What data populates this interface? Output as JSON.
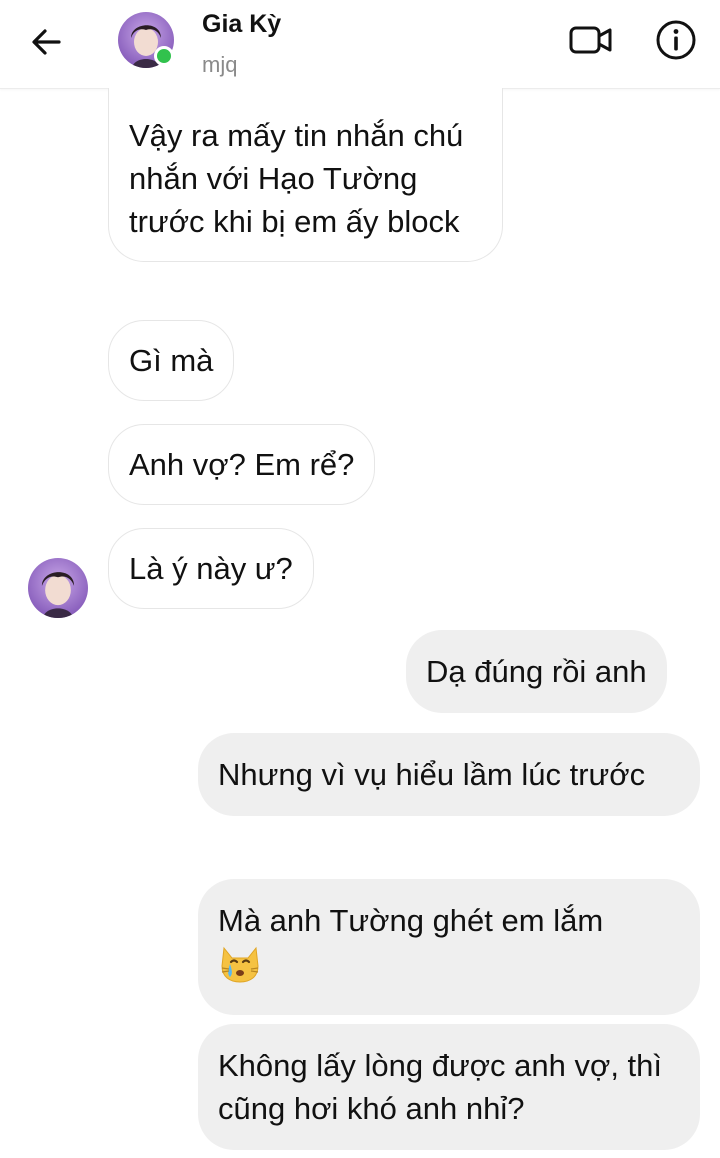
{
  "header": {
    "name": "Gia Kỳ",
    "subtitle": "mjq",
    "online_color": "#31c24d"
  },
  "messages": [
    {
      "side": "incoming",
      "text": "Vậy ra mấy tin nhắn chú nhắn với Hạo Tường trước khi bị em ấy block"
    },
    {
      "side": "incoming",
      "text": "Gì mà"
    },
    {
      "side": "incoming",
      "text": "Anh vợ? Em rể?"
    },
    {
      "side": "incoming",
      "text": "Là ý này ư?"
    },
    {
      "side": "outgoing",
      "text": "Dạ đúng rồi anh"
    },
    {
      "side": "outgoing",
      "text": "Nhưng vì vụ hiểu lầm lúc trước"
    },
    {
      "side": "outgoing",
      "text": "Mà anh Tường ghét em lắm",
      "emoji": "crying-cat-face"
    },
    {
      "side": "outgoing",
      "text": "Không lấy lòng được anh vợ, thì cũng hơi khó anh nhỉ?"
    }
  ],
  "icons": {
    "back": "arrow-left-icon",
    "video": "video-camera-icon",
    "info": "info-icon"
  }
}
